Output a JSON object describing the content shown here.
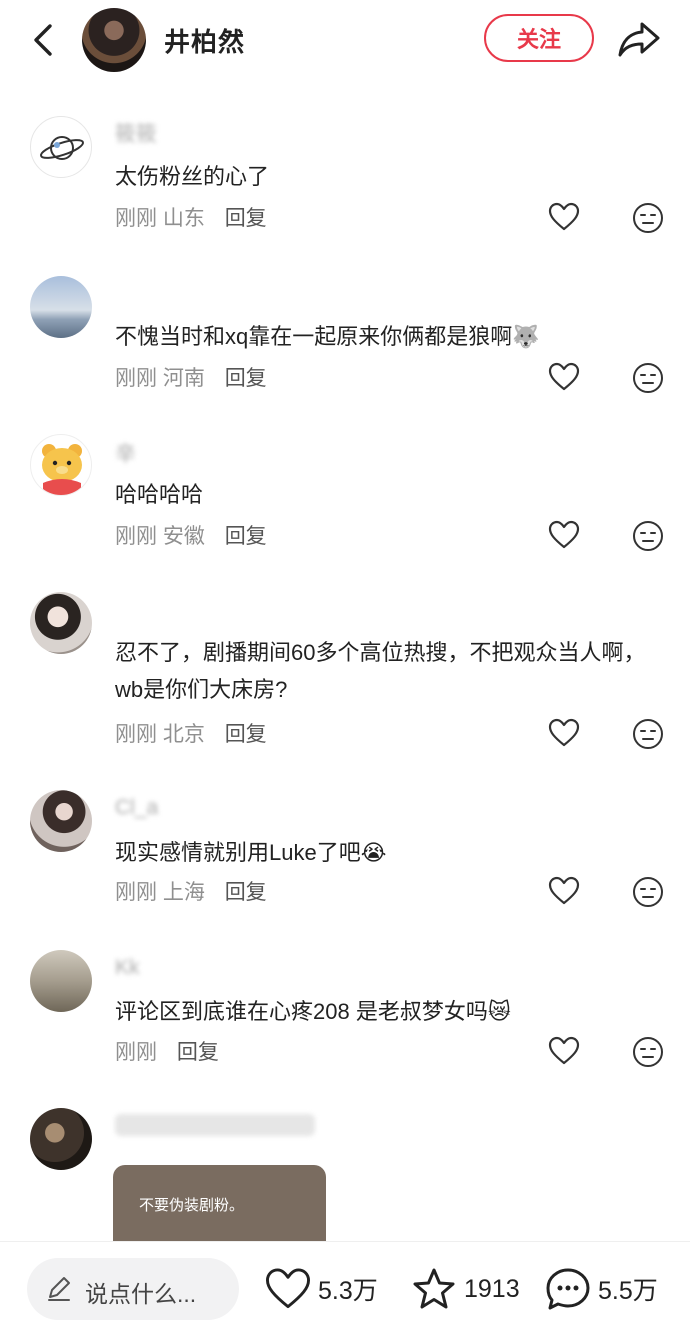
{
  "header": {
    "back_icon": "chevron-left-icon",
    "name": "井柏然",
    "follow_label": "关注",
    "share_icon": "share-arrow-icon",
    "accent_color": "#e8394a"
  },
  "comments": [
    {
      "user": "筱筱",
      "text": "太伤粉丝的心了",
      "time": "刚刚",
      "location": "山东",
      "reply": "回复"
    },
    {
      "user": "",
      "text": "不愧当时和xq靠在一起原来你俩都是狼啊🐺",
      "time": "刚刚",
      "location": "河南",
      "reply": "回复"
    },
    {
      "user": "辛",
      "text": "哈哈哈哈",
      "time": "刚刚",
      "location": "安徽",
      "reply": "回复"
    },
    {
      "user": "",
      "text": "忍不了，剧播期间60多个高位热搜，不把观众当人啊，wb是你们大床房?",
      "time": "刚刚",
      "location": "北京",
      "reply": "回复"
    },
    {
      "user": "Cl_a",
      "text": "现实感情就别用Luke了吧😭",
      "time": "刚刚",
      "location": "上海",
      "reply": "回复"
    },
    {
      "user": "Kk",
      "text": "评论区到底谁在心疼208 是老叔梦女吗😿",
      "time": "刚刚",
      "location": "",
      "reply": "回复"
    },
    {
      "user": "",
      "text": "",
      "time": "",
      "location": "",
      "reply": ""
    }
  ],
  "image_card": {
    "text": "不要伪装剧粉。"
  },
  "bottom": {
    "input_placeholder": "说点什么...",
    "likes": "5.3万",
    "favorites": "1913",
    "comments": "5.5万"
  }
}
